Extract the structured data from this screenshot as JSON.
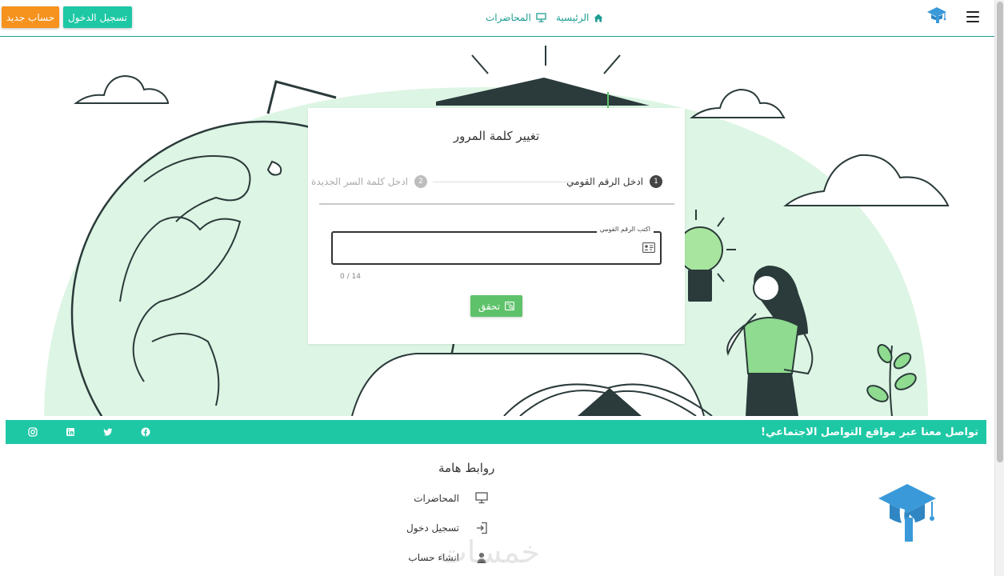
{
  "header": {
    "register_label": "حساب جديد",
    "login_label": "تسجيل الدخول",
    "nav_home": "الرئيسية",
    "nav_lectures": "المحاضرات"
  },
  "card": {
    "title": "تغيير كلمة المرور",
    "step1_num": "1",
    "step1_label": "ادخل الرقم القومي",
    "step2_num": "2",
    "step2_label": "ادخل كلمة السر الجديدة",
    "field_label": "اكتب الرقم القومي",
    "field_value": "",
    "counter": "0 / 14",
    "verify_label": "تحقق"
  },
  "social": {
    "text": "تواصل معنا عبر مواقع التواصل الاجتماعي!"
  },
  "footer": {
    "title": "روابط هامة",
    "links": [
      "المحاضرات",
      "تسجيل دخول",
      "انشاء حساب"
    ]
  },
  "watermark": "خمسات",
  "colors": {
    "teal": "#1ec8a5",
    "orange": "#f6921e",
    "green_button": "#5ec26a",
    "globe_fill": "#ddf5e4",
    "logo_blue": "#3a9ad9"
  }
}
